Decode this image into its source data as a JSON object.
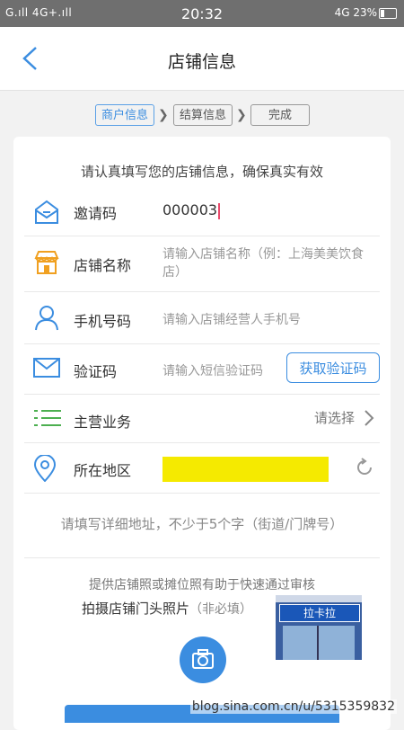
{
  "status_bar": {
    "left": "G.ıll 4G+.ıll",
    "time": "20:32",
    "right": "4G 23%"
  },
  "nav": {
    "title": "店铺信息"
  },
  "steps": [
    {
      "label": "商户信息",
      "active": true
    },
    {
      "label": "结算信息",
      "active": false
    },
    {
      "label": "完成",
      "active": false
    }
  ],
  "form": {
    "notice": "请认真填写您的店铺信息，确保真实有效",
    "invite": {
      "label": "邀请码",
      "value": "000003"
    },
    "store_name": {
      "label": "店铺名称",
      "placeholder_line1": "请输入店铺名称（例：上海美美饮食",
      "placeholder_line2": "店）"
    },
    "phone": {
      "label": "手机号码",
      "placeholder": "请输入店铺经营人手机号"
    },
    "verify": {
      "label": "验证码",
      "placeholder": "请输入短信验证码",
      "button": "获取验证码"
    },
    "business": {
      "label": "主营业务",
      "select": "请选择"
    },
    "region": {
      "label": "所在地区"
    },
    "address_hint": "请填写详细地址，不少于5个字（街道/门牌号）",
    "photo_tip": "提供店铺照或摊位照有助于快速通过审核",
    "photo_title": "拍摄店铺门头照片",
    "photo_optional": "（非必填）",
    "sample_sign": "拉卡拉"
  },
  "watermark": "blog.sina.com.cn/u/5315359832",
  "colors": {
    "accent": "#3b8de0",
    "status_bar": "#6f6f6f",
    "highlight": "#f5ea00"
  }
}
